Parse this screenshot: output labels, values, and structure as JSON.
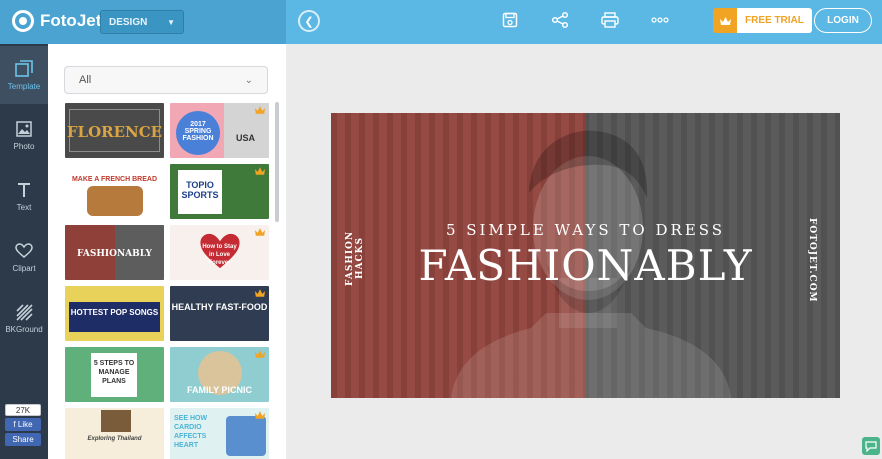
{
  "header": {
    "app_name": "FotoJet",
    "mode_select": "DESIGN",
    "free_trial_label": "FREE TRIAL",
    "login_label": "LOGIN"
  },
  "nav": [
    {
      "label": "Template",
      "icon": "template-icon"
    },
    {
      "label": "Photo",
      "icon": "photo-icon"
    },
    {
      "label": "Text",
      "icon": "text-icon"
    },
    {
      "label": "Clipart",
      "icon": "heart-icon"
    },
    {
      "label": "BKGround",
      "icon": "background-icon"
    }
  ],
  "social": {
    "count": "27K",
    "like": "Like",
    "share": "Share"
  },
  "panel": {
    "filter_value": "All",
    "templates": [
      {
        "caption": "FLORENCE"
      },
      {
        "caption": "2017 SPRING FASHION"
      },
      {
        "caption": "MAKE A FRENCH BREAD"
      },
      {
        "caption": "TOPIO SPORTS"
      },
      {
        "caption": "FASHIONABLY"
      },
      {
        "caption": "How to Stay in Love Forever"
      },
      {
        "caption": "HOTTEST POP SONGS"
      },
      {
        "caption": "HEALTHY FAST-FOOD"
      },
      {
        "caption": "5 STEPS TO MANAGE PLANS"
      },
      {
        "caption": "FAMILY PICNIC"
      },
      {
        "caption": "Exploring Thailand"
      },
      {
        "caption": "SEE HOW CARDIO AFFECTS HEART"
      }
    ]
  },
  "canvas": {
    "side_left": "FASHION HACKS",
    "side_right": "FOTOJET.COM",
    "subtitle": "5 SIMPLE WAYS TO DRESS",
    "headline": "FASHIONABLY"
  },
  "colors": {
    "header": "#5bb7e3",
    "sidebar": "#2c3a4a",
    "accent_orange": "#f1a323",
    "canvas_red": "#93463f"
  }
}
